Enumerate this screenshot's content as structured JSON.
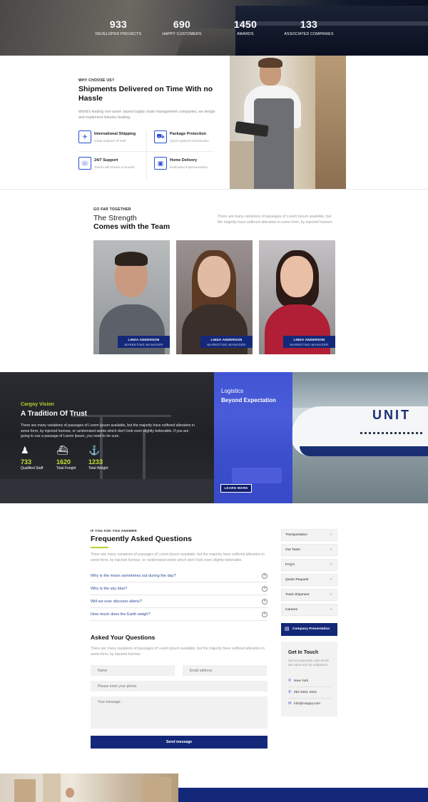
{
  "stats": [
    {
      "value": "933",
      "label": "DEVELOPED PROJECTS"
    },
    {
      "value": "690",
      "label": "HAPPY CUSTOMERS"
    },
    {
      "value": "1450",
      "label": "AWARDS"
    },
    {
      "value": "133",
      "label": "ASSOCIATED COMPANIES"
    }
  ],
  "why": {
    "eyebrow": "WHY CHOOSE US?",
    "title": "Shipments Delivered on Time With no Hassle",
    "description": "World's leading non-asset- based supply chain management companies, we design and implement industry-leading.",
    "features": [
      {
        "title": "International Shipping",
        "subtitle": "Great explorer of truth",
        "icon": "plane-icon"
      },
      {
        "title": "Package Protection",
        "subtitle": "Quick systems introduction",
        "icon": "truck-icon"
      },
      {
        "title": "24/7 Support",
        "subtitle": "Teams will ensure a smooth",
        "icon": "phone-icon"
      },
      {
        "title": "Home Delivery",
        "subtitle": "Dedicated implementation",
        "icon": "box-icon"
      }
    ]
  },
  "team": {
    "eyebrow": "GO FAR TOGETHER",
    "title_line1": "The Strength",
    "title_line2": "Comes with the Team",
    "description": "There are many variations of passages of Lorem Ipsum available, but the majority have suffered alteration in some form, by injected humour.",
    "members": [
      {
        "name": "LINDA ANDERSON",
        "role": "MARKETING MANAGER"
      },
      {
        "name": "LINDA ANDERSON",
        "role": "MARKETING MANAGER"
      },
      {
        "name": "LINDA ANDERSON",
        "role": "MARKETING MANAGER"
      }
    ]
  },
  "trust": {
    "eyebrow": "Cargoy Vision",
    "title": "A Tradition Of Trust",
    "description": "There are many variations of passages of Lorem Ipsum available, but the majority have suffered alteration in some form, by injected humour, or randomised words which don't look even slightly believable. If you are going to use a passage of Lorem Ipsum, you need to be sure.",
    "stats": [
      {
        "value": "733",
        "label": "Qualified Staff",
        "icon": "person-icon"
      },
      {
        "value": "1620",
        "label": "Total Freight",
        "icon": "ship-icon"
      },
      {
        "value": "1233",
        "label": "Total Weight",
        "icon": "crane-icon"
      }
    ]
  },
  "logistics": {
    "line1": "Logistics",
    "line2": "Beyond Expectation",
    "button": "LEARN MORE",
    "plane_text": "UNIT"
  },
  "faq": {
    "eyebrow": "IF YOU ASK YOU ANSWER",
    "title": "Frequently Asked Questions",
    "description": "There are many variations of passages of Lorem Ipsum available, but the majority have suffered alteration in some form, by injected humour, or randomised words which don't look even slightly believable.",
    "questions": [
      "Why is the moon sometimes out during the day?",
      "Why is the sky blue?",
      "Will we ever discover aliens?",
      "How much does the Earth weigh?"
    ]
  },
  "ask": {
    "title": "Asked Your Questions",
    "description": "There are many variations of passages of Lorem Ipsum available, but the majority have suffered alteration in some form, by injected humour.",
    "name_placeholder": "Name",
    "email_placeholder": "Email address",
    "phone_placeholder": "Please enter your phone",
    "message_placeholder": "Your message",
    "send_label": "Send message"
  },
  "sidebar": {
    "items": [
      "Transportation",
      "Our Team",
      "FAQ's",
      "Quote Request",
      "Track Shipment",
      "Careers"
    ],
    "presentation": "Company Presentation",
    "touch_title": "Get In Touch",
    "touch_desc": "Sed ut perspiciatis unde omnis iste natus error sit voluptatem.",
    "location": "New York",
    "phone": "052 5401 3322",
    "email": "info@cargoy.com"
  },
  "colors": {
    "navy": "#14287a",
    "blue_accent": "#2a4fd6",
    "lime": "#b3d430"
  }
}
